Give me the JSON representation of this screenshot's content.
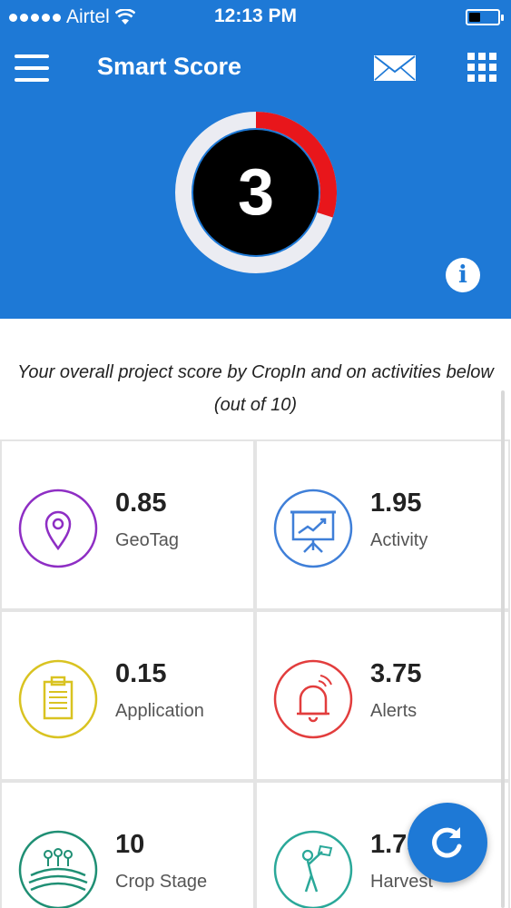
{
  "status_bar": {
    "carrier": "Airtel",
    "time": "12:13 PM",
    "battery_level": 0.25
  },
  "header": {
    "title": "Smart Score",
    "score": "3",
    "score_fraction": 0.3,
    "info_label": "i"
  },
  "description": "Your overall project score by CropIn and on activities below (out of 10)",
  "cards": [
    {
      "value": "0.85",
      "label": "GeoTag",
      "icon": "map-pin-icon",
      "color": "#8e2ec4"
    },
    {
      "value": "1.95",
      "label": "Activity",
      "icon": "presentation-board-icon",
      "color": "#3f7fd8"
    },
    {
      "value": "0.15",
      "label": "Application",
      "icon": "clipboard-icon",
      "color": "#d9c321"
    },
    {
      "value": "3.75",
      "label": "Alerts",
      "icon": "bell-icon",
      "color": "#e23d3d"
    },
    {
      "value": "10",
      "label": "Crop Stage",
      "icon": "crop-field-icon",
      "color": "#1f8f74"
    },
    {
      "value": "1.75",
      "label": "Harvest",
      "icon": "harvest-worker-icon",
      "color": "#2aa899"
    }
  ],
  "colors": {
    "brand": "#1e79d6",
    "score_arc": "#e8161b",
    "score_track": "#ebecf2"
  }
}
